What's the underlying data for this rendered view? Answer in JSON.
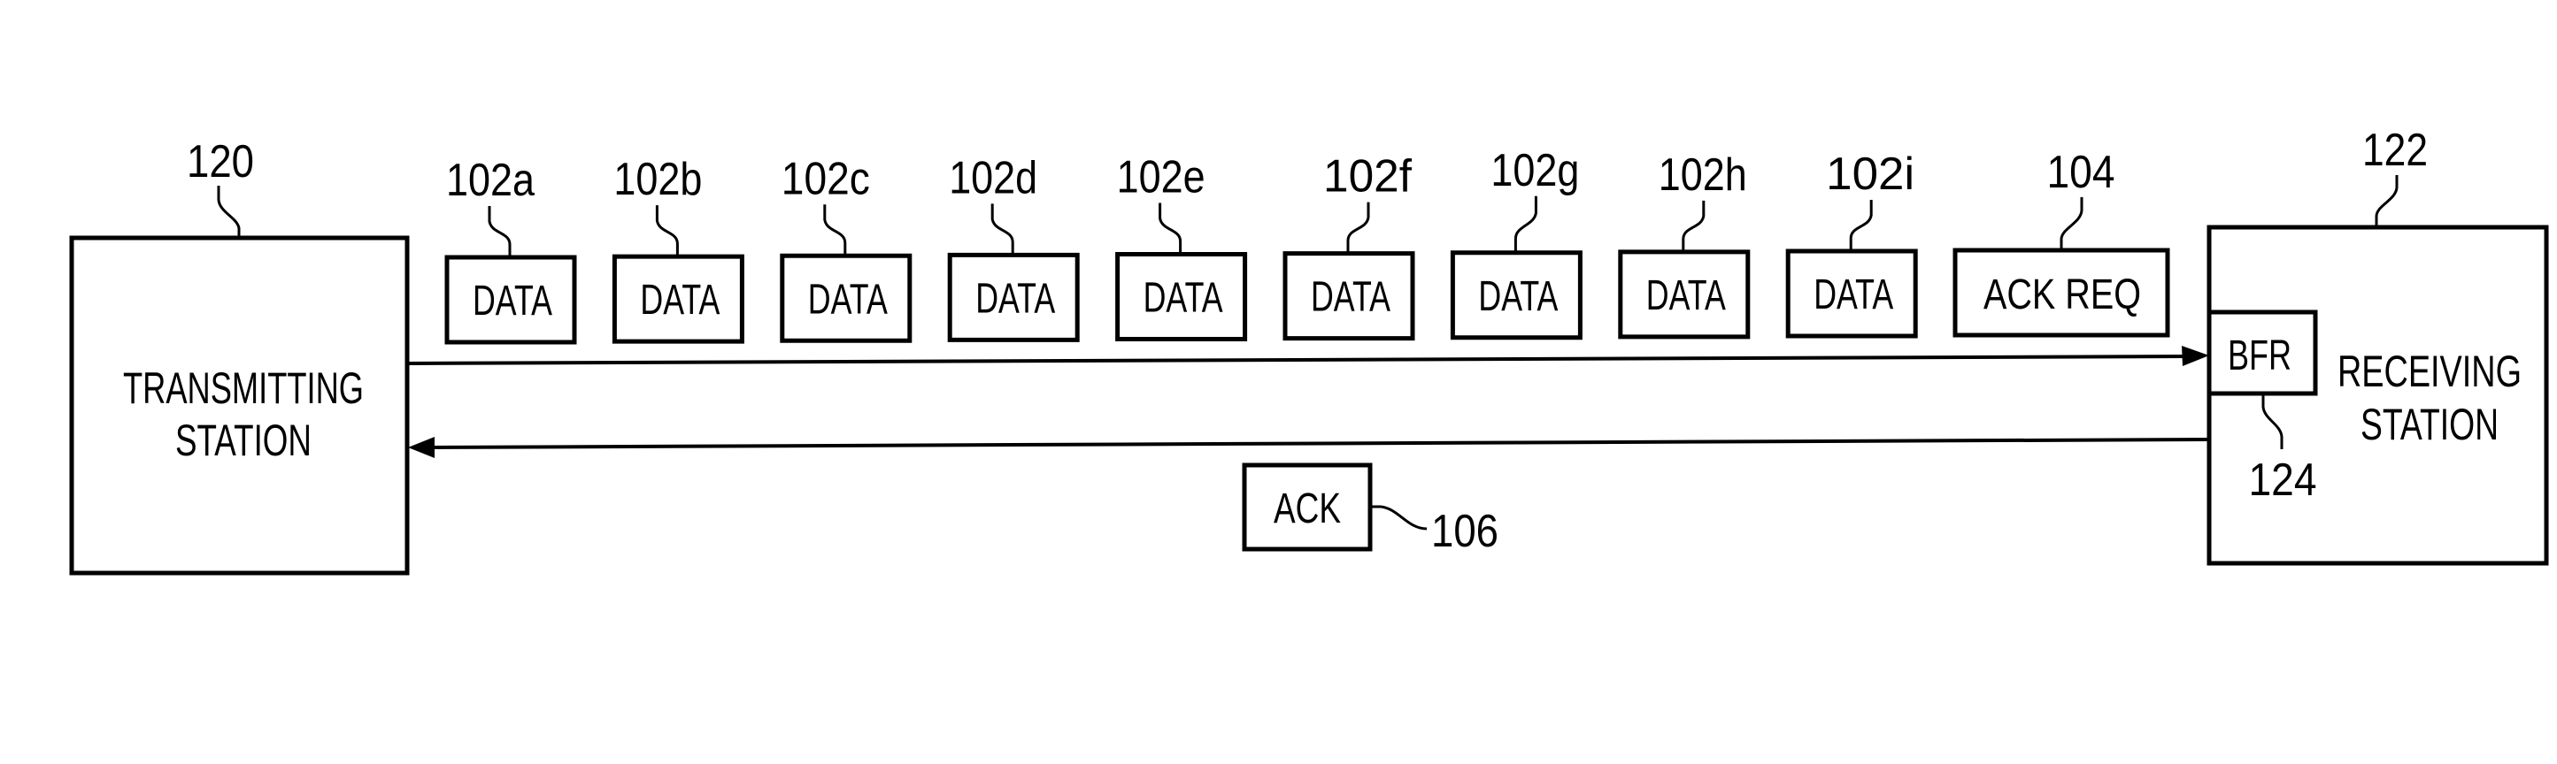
{
  "figure": {
    "transmitting_station": {
      "ref": "120",
      "label_lines": [
        "TRANSMITTING",
        "STATION"
      ]
    },
    "receiving_station": {
      "ref": "122",
      "label_lines": [
        "RECEIVING",
        "STATION"
      ],
      "buffer": {
        "ref": "124",
        "label": "BFR"
      }
    },
    "forward_frames": [
      {
        "ref": "102a",
        "label": "DATA"
      },
      {
        "ref": "102b",
        "label": "DATA"
      },
      {
        "ref": "102c",
        "label": "DATA"
      },
      {
        "ref": "102d",
        "label": "DATA"
      },
      {
        "ref": "102e",
        "label": "DATA"
      },
      {
        "ref": "102f",
        "label": "DATA"
      },
      {
        "ref": "102g",
        "label": "DATA"
      },
      {
        "ref": "102h",
        "label": "DATA"
      },
      {
        "ref": "102i",
        "label": "DATA"
      }
    ],
    "ack_request": {
      "ref": "104",
      "label": "ACK REQ"
    },
    "ack": {
      "ref": "106",
      "label": "ACK"
    },
    "colors": {
      "ink": "#000000",
      "paper": "#ffffff"
    }
  }
}
